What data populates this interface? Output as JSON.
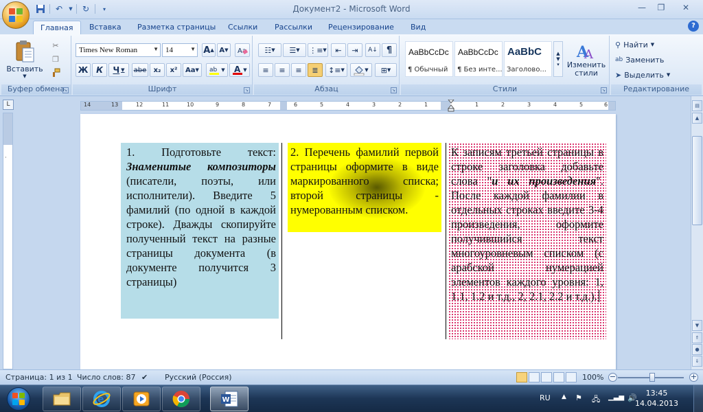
{
  "window": {
    "title": "Документ2 - Microsoft Word",
    "minimize": "—",
    "maximize": "❐",
    "close": "✕"
  },
  "ribbon_tabs": [
    "Главная",
    "Вставка",
    "Разметка страницы",
    "Ссылки",
    "Рассылки",
    "Рецензирование",
    "Вид"
  ],
  "help": "?",
  "groups": {
    "clipboard": {
      "label": "Буфер обмена",
      "paste": "Вставить"
    },
    "font": {
      "label": "Шрифт",
      "font_name": "Times New Roman",
      "font_size": "14",
      "bold": "Ж",
      "italic": "К",
      "underline": "Ч",
      "strike": "abe",
      "subscript": "x₂",
      "superscript": "x²",
      "change_case": "Aa",
      "font_color": "A",
      "grow": "A",
      "shrink": "A"
    },
    "paragraph": {
      "label": "Абзац",
      "pilcrow": "¶"
    },
    "styles": {
      "label": "Стили",
      "items": [
        {
          "sample": "AaBbCcDc",
          "name": "¶ Обычный"
        },
        {
          "sample": "AaBbCcDc",
          "name": "¶ Без инте..."
        },
        {
          "sample": "AaBbC",
          "name": "Заголово..."
        }
      ],
      "change_styles": "Изменить стили"
    },
    "editing": {
      "label": "Редактирование",
      "find": "Найти",
      "replace": "Заменить",
      "select": "Выделить"
    }
  },
  "ruler": {
    "corner": "L",
    "ticks": [
      "14",
      "13",
      "12",
      "11",
      "10",
      "9",
      "8",
      "7",
      "6",
      "5",
      "4",
      "3",
      "2",
      "1",
      "1",
      "2",
      "3",
      "4",
      "5",
      "6"
    ]
  },
  "document": {
    "col1": {
      "lead": "1. Подготовьте текст: ",
      "emphasis": "Знаменитые композиторы",
      "rest": " (писатели, поэты, или исполнители). Введите 5 фамилий (по одной в каждой строке). Дважды скопируйте полученный текст на разные страницы документа (в документе получится 3 страницы)"
    },
    "col2": {
      "text": "2. Перечень фамилий первой страницы оформите в виде маркированного списка; второй страницы - нумерованным списком."
    },
    "col3": {
      "lead": "К записям третьей страницы в строке заголовка добавьте слова \"",
      "emphasis": "и их произведения",
      "rest": "\". После каждой фамилии в отдельных строках введите 3-4 произведения, оформите получившийся текст многоуровневым списком (с арабской нумерацией элементов каждого уровня: 1, 1.1, 1.2 и т.д., 2, 2.1, 2.2 и т.д.)."
    }
  },
  "status": {
    "page": "Страница: 1 из 1",
    "words": "Число слов: 87",
    "language": "Русский (Россия)",
    "zoom": "100%",
    "zoom_minus": "−",
    "zoom_plus": "+"
  },
  "taskbar": {
    "lang": "RU",
    "time": "13:45",
    "date": "14.04.2013"
  },
  "colors": {
    "cell1_bg": "#b6dde8",
    "cell2_bg": "#ffff00",
    "cell3_pattern": "#d5185a"
  }
}
